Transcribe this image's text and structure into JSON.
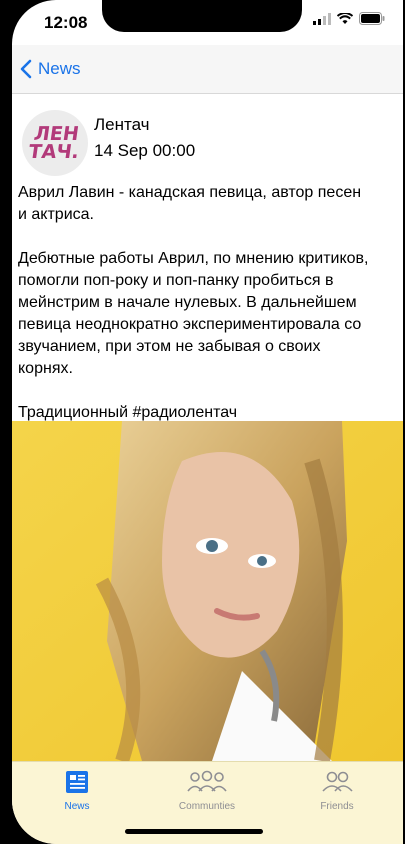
{
  "status": {
    "time": "12:08"
  },
  "nav": {
    "back_label": "News"
  },
  "post": {
    "avatar_text_line1": "ЛЕН",
    "avatar_text_line2": "ТАЧ.",
    "author": "Лентач",
    "date": "14 Sep 00:00",
    "text": "Аврил Лавин - канадская певица, автор песен\nи актриса.\n\nДебютные работы Аврил, по мнению критиков,\nпомогли поп-року и поп-панку пробиться в\nмейнстрим в начале нулевых. В дальнейшем\nпевица неоднократно экспериментировала со\nзвучанием, при этом не забывая о своих\nкорнях.\n\nТрадиционный #радиолентач"
  },
  "tabs": [
    {
      "label": "News",
      "active": true
    },
    {
      "label": "Communties",
      "active": false
    },
    {
      "label": "Friends",
      "active": false
    }
  ],
  "colors": {
    "accent": "#1a73e8",
    "tab_inactive": "#8e8e93",
    "tabbar_bg": "#fbf5d4",
    "image_bg": "#f2d03c"
  }
}
